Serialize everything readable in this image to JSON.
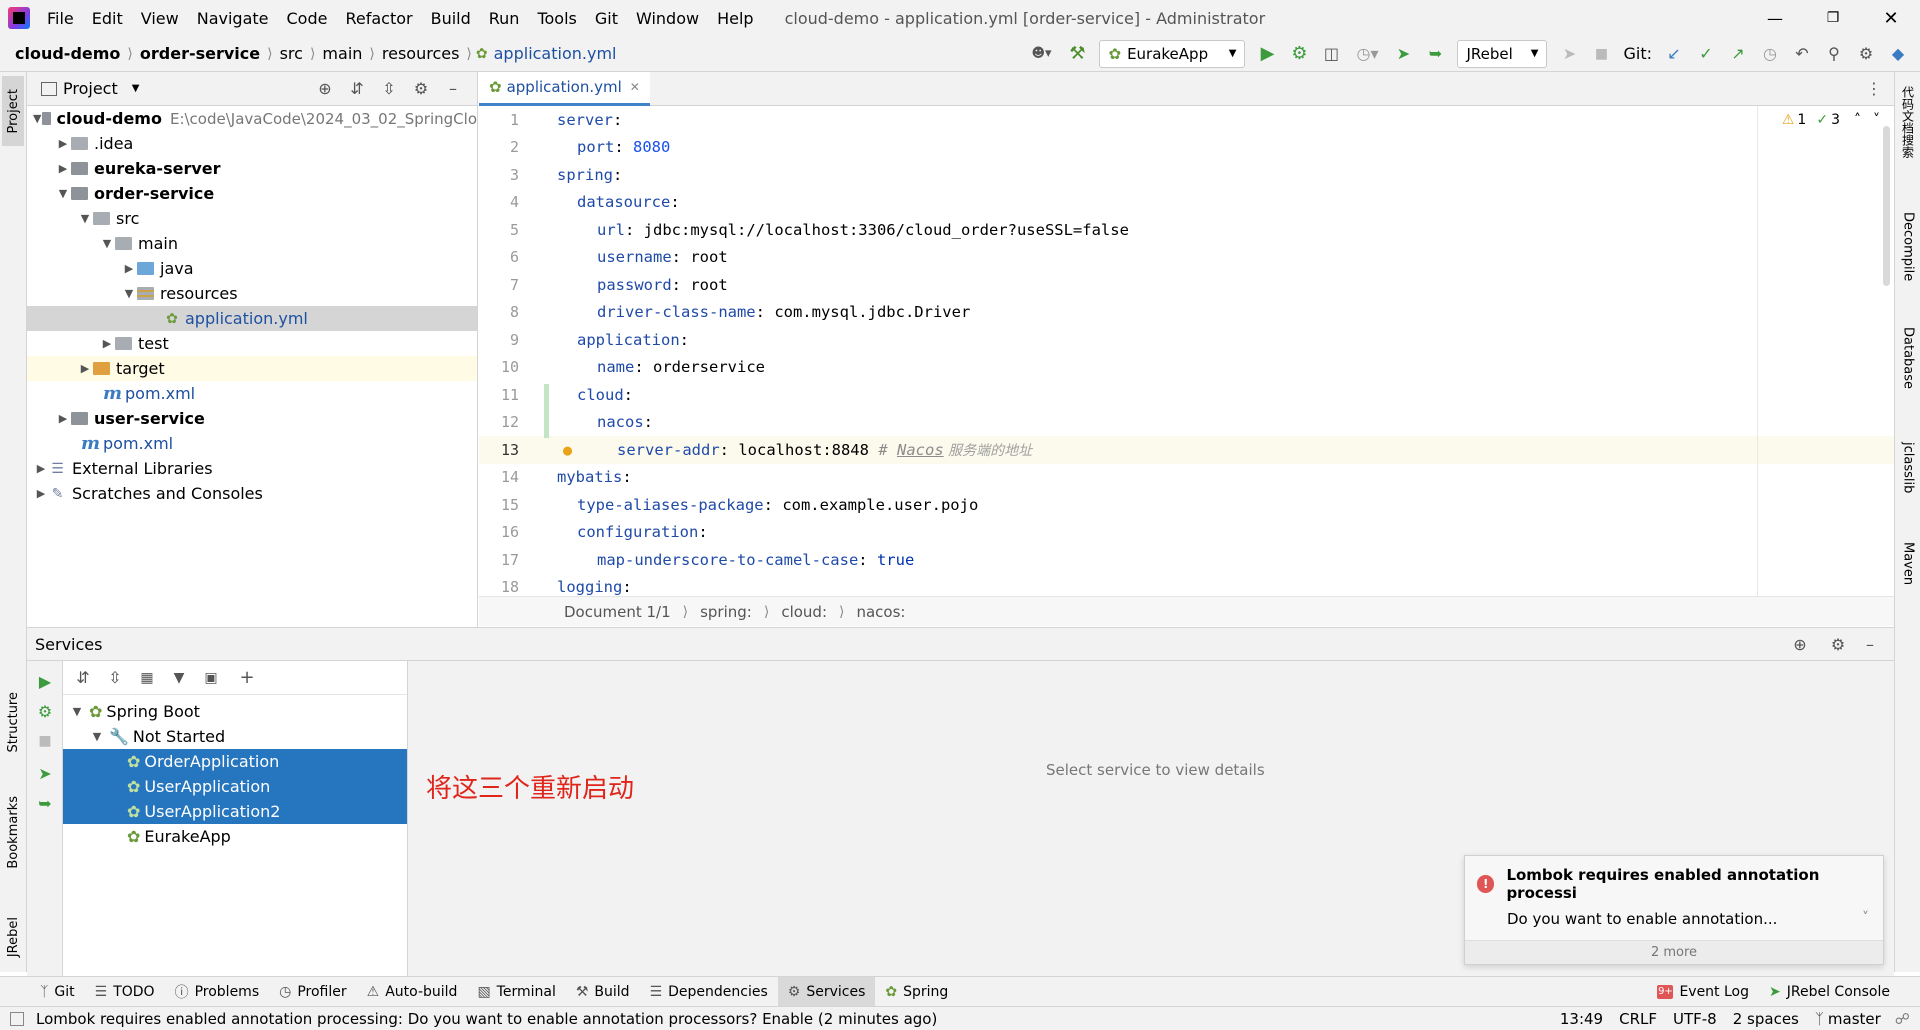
{
  "titlebar": {
    "menu": [
      "File",
      "Edit",
      "View",
      "Navigate",
      "Code",
      "Refactor",
      "Build",
      "Run",
      "Tools",
      "Git",
      "Window",
      "Help"
    ],
    "title": "cloud-demo - application.yml [order-service] - Administrator"
  },
  "navbar": {
    "crumbs": [
      "cloud-demo",
      "order-service",
      "src",
      "main",
      "resources",
      "application.yml"
    ],
    "run_config": "EurakeApp",
    "jrebel_config": "JRebel",
    "git_label": "Git:"
  },
  "left_strip": {
    "project": "Project",
    "structure": "Structure",
    "bookmarks": "Bookmarks",
    "jrebel": "JRebel"
  },
  "right_strip": {
    "search": "代码文档搜索",
    "decompile": "Decompile",
    "database": "Database",
    "jclasslib": "jclasslib",
    "maven": "Maven"
  },
  "project_panel": {
    "title": "Project",
    "root_path": "E:\\code\\JavaCode\\2024_03_02_SpringClo",
    "tree": [
      {
        "label": "cloud-demo",
        "bold": true
      },
      {
        "label": ".idea"
      },
      {
        "label": "eureka-server",
        "bold": true
      },
      {
        "label": "order-service",
        "bold": true
      },
      {
        "label": "src"
      },
      {
        "label": "main"
      },
      {
        "label": "java"
      },
      {
        "label": "resources"
      },
      {
        "label": "application.yml"
      },
      {
        "label": "test"
      },
      {
        "label": "target"
      },
      {
        "label": "pom.xml"
      },
      {
        "label": "user-service",
        "bold": true
      },
      {
        "label": "pom.xml"
      },
      {
        "label": "External Libraries"
      },
      {
        "label": "Scratches and Consoles"
      }
    ]
  },
  "editor": {
    "tab_label": "application.yml",
    "warnings": "1",
    "checks": "3",
    "line_numbers": [
      "1",
      "2",
      "3",
      "4",
      "5",
      "6",
      "7",
      "8",
      "9",
      "10",
      "11",
      "12",
      "13",
      "14",
      "15",
      "16",
      "17",
      "18"
    ],
    "lines": [
      {
        "key": "server",
        "sep": ":",
        "val": ""
      },
      {
        "key": "port",
        "sep": ": ",
        "val": "8080"
      },
      {
        "key": "spring",
        "sep": ":",
        "val": ""
      },
      {
        "key": "datasource",
        "sep": ":",
        "val": ""
      },
      {
        "key": "url",
        "sep": ": ",
        "val": "jdbc:mysql://localhost:3306/cloud_order?useSSL=false"
      },
      {
        "key": "username",
        "sep": ": ",
        "val": "root"
      },
      {
        "key": "password",
        "sep": ": ",
        "val": "root"
      },
      {
        "key": "driver-class-name",
        "sep": ": ",
        "val": "com.mysql.jdbc.Driver"
      },
      {
        "key": "application",
        "sep": ":",
        "val": ""
      },
      {
        "key": "name",
        "sep": ": ",
        "val": "orderservice"
      },
      {
        "key": "cloud",
        "sep": ":",
        "val": ""
      },
      {
        "key": "nacos",
        "sep": ":",
        "val": ""
      },
      {
        "key": "server-addr",
        "sep": ": ",
        "val": "localhost:8848",
        "comment_hash": "# ",
        "comment_word": "Nacos",
        "comment_rest": " 服务端的地址"
      },
      {
        "key": "mybatis",
        "sep": ":",
        "val": ""
      },
      {
        "key": "type-aliases-package",
        "sep": ": ",
        "val": "com.example.user.pojo"
      },
      {
        "key": "configuration",
        "sep": ":",
        "val": ""
      },
      {
        "key": "map-underscore-to-camel-case",
        "sep": ": ",
        "val": "true"
      },
      {
        "key": "logging",
        "sep": ":",
        "val": ""
      }
    ],
    "breadcrumbs": [
      "Document 1/1",
      "spring:",
      "cloud:",
      "nacos:"
    ]
  },
  "services": {
    "title": "Services",
    "tree": [
      "Spring Boot",
      "Not Started",
      "OrderApplication",
      "UserApplication",
      "UserApplication2",
      "EurakeApp"
    ],
    "detail_placeholder": "Select service to view details",
    "annotation": "将这三个重新启动"
  },
  "notification": {
    "title": "Lombok requires enabled annotation processi",
    "body": "Do you want to enable annotation...",
    "more": "2 more"
  },
  "bottom_tabs": {
    "left": [
      "Git",
      "TODO",
      "Problems",
      "Profiler",
      "Auto-build",
      "Terminal",
      "Build",
      "Dependencies",
      "Services",
      "Spring"
    ],
    "right": [
      "Event Log",
      "JRebel Console"
    ]
  },
  "statusbar": {
    "message": "Lombok requires enabled annotation processing: Do you want to enable annotation processors? Enable (2 minutes ago)",
    "position": "13:49",
    "line_sep": "CRLF",
    "encoding": "UTF-8",
    "indent": "2 spaces",
    "branch": "master"
  }
}
